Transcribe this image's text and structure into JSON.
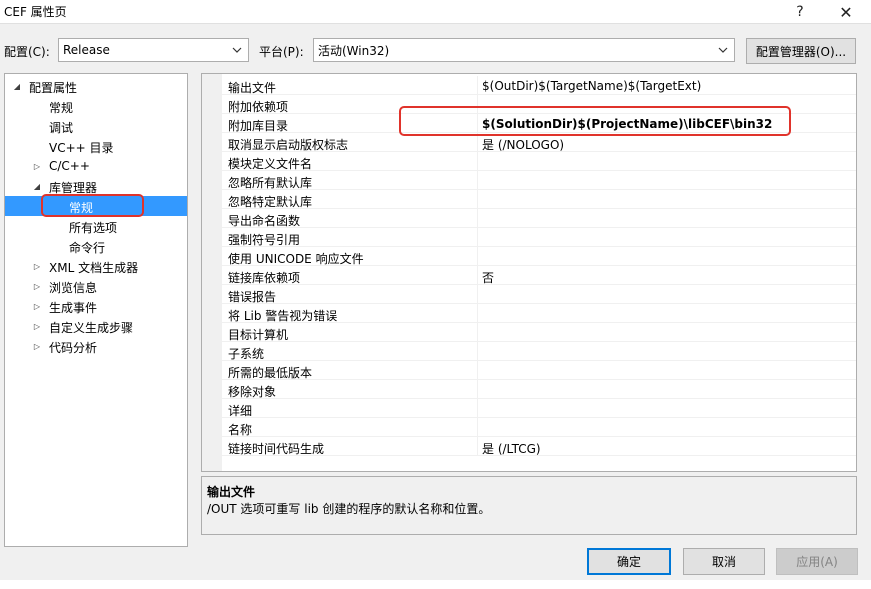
{
  "window": {
    "title": "CEF 属性页",
    "help_glyph": "?",
    "close_glyph": "✕"
  },
  "config": {
    "config_label": "配置(C):",
    "config_value": "Release",
    "platform_label": "平台(P):",
    "platform_value": "活动(Win32)",
    "manager_button": "配置管理器(O)..."
  },
  "tree": {
    "items": [
      {
        "label": "配置属性",
        "expander": "◢"
      },
      {
        "label": "常规",
        "expander": ""
      },
      {
        "label": "调试",
        "expander": ""
      },
      {
        "label": "VC++ 目录",
        "expander": ""
      },
      {
        "label": "C/C++",
        "expander": "▷"
      },
      {
        "label": "库管理器",
        "expander": "◢"
      },
      {
        "label": "常规",
        "expander": ""
      },
      {
        "label": "所有选项",
        "expander": ""
      },
      {
        "label": "命令行",
        "expander": ""
      },
      {
        "label": "XML 文档生成器",
        "expander": "▷"
      },
      {
        "label": "浏览信息",
        "expander": "▷"
      },
      {
        "label": "生成事件",
        "expander": "▷"
      },
      {
        "label": "自定义生成步骤",
        "expander": "▷"
      },
      {
        "label": "代码分析",
        "expander": "▷"
      }
    ]
  },
  "grid": {
    "rows": [
      {
        "name": "输出文件",
        "value": "$(OutDir)$(TargetName)$(TargetExt)"
      },
      {
        "name": "附加依赖项",
        "value": ""
      },
      {
        "name": "附加库目录",
        "value": "$(SolutionDir)$(ProjectName)\\libCEF\\bin32"
      },
      {
        "name": "取消显示启动版权标志",
        "value": "是 (/NOLOGO)"
      },
      {
        "name": "模块定义文件名",
        "value": ""
      },
      {
        "name": "忽略所有默认库",
        "value": ""
      },
      {
        "name": "忽略特定默认库",
        "value": ""
      },
      {
        "name": "导出命名函数",
        "value": ""
      },
      {
        "name": "强制符号引用",
        "value": ""
      },
      {
        "name": "使用 UNICODE 响应文件",
        "value": ""
      },
      {
        "name": "链接库依赖项",
        "value": "否"
      },
      {
        "name": "错误报告",
        "value": ""
      },
      {
        "name": "将 Lib 警告视为错误",
        "value": ""
      },
      {
        "name": "目标计算机",
        "value": ""
      },
      {
        "name": "子系统",
        "value": ""
      },
      {
        "name": "所需的最低版本",
        "value": ""
      },
      {
        "name": "移除对象",
        "value": ""
      },
      {
        "name": "详细",
        "value": ""
      },
      {
        "name": "名称",
        "value": ""
      },
      {
        "name": "链接时间代码生成",
        "value": "是 (/LTCG)"
      }
    ]
  },
  "description": {
    "title": "输出文件",
    "text": "/OUT 选项可重写 lib 创建的程序的默认名称和位置。"
  },
  "buttons": {
    "ok": "确定",
    "cancel": "取消",
    "apply": "应用(A)"
  },
  "colors": {
    "selection": "#3399ff",
    "highlight": "#e0332b",
    "accent": "#0078d7"
  }
}
